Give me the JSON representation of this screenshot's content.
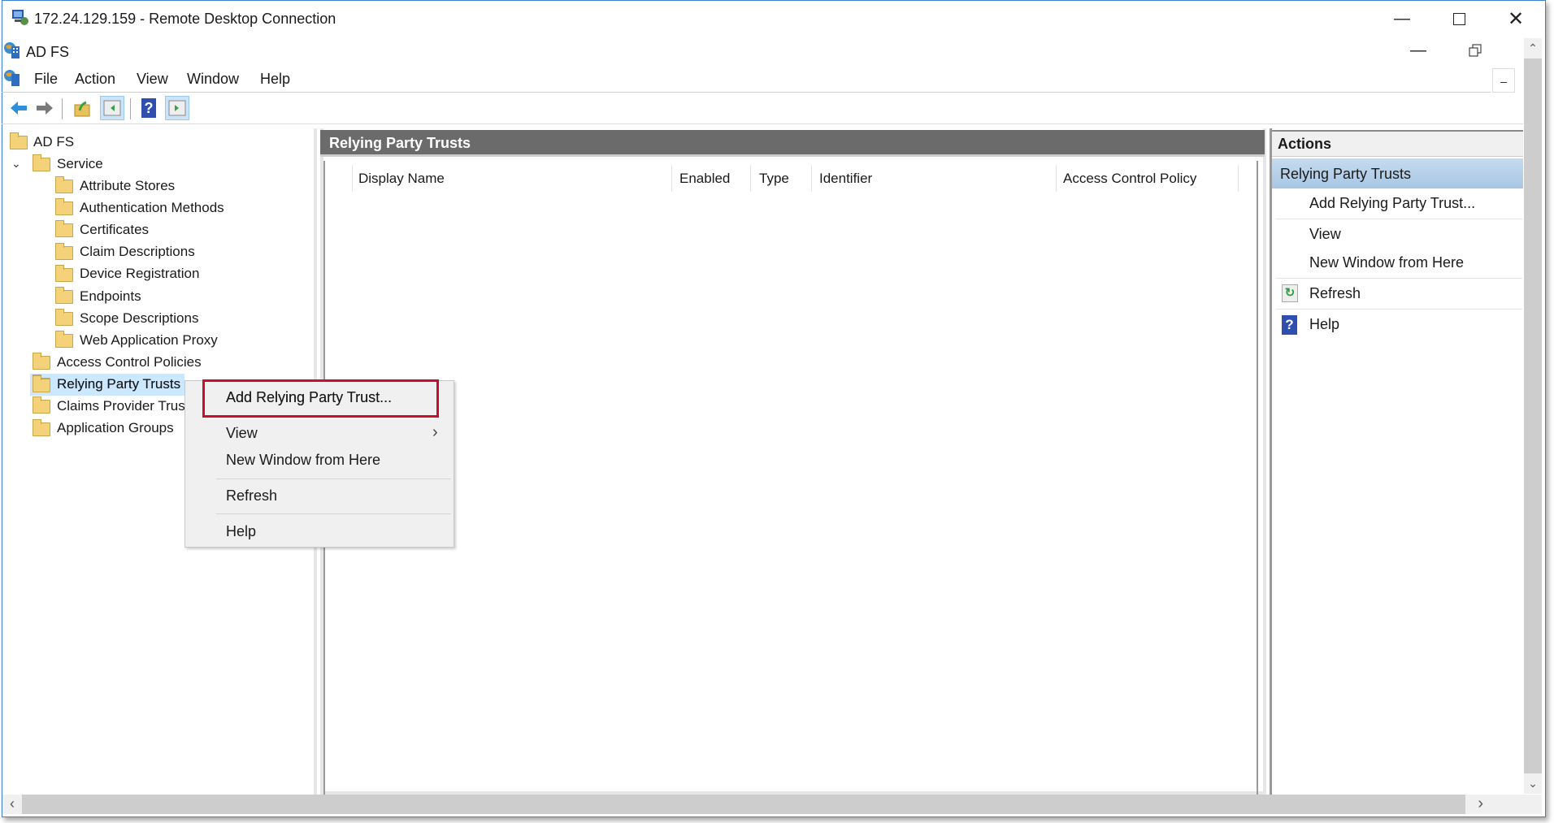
{
  "rdp": {
    "title": "172.24.129.159 - Remote Desktop Connection"
  },
  "mmc": {
    "title": "AD FS"
  },
  "menu": [
    "File",
    "Action",
    "View",
    "Window",
    "Help"
  ],
  "tree": {
    "root": "AD FS",
    "service": "Service",
    "service_children": [
      "Attribute Stores",
      "Authentication Methods",
      "Certificates",
      "Claim Descriptions",
      "Device Registration",
      "Endpoints",
      "Scope Descriptions",
      "Web Application Proxy"
    ],
    "top_items": [
      "Access Control Policies",
      "Relying Party Trusts",
      "Claims Provider Trusts",
      "Application Groups"
    ],
    "selected": "Relying Party Trusts"
  },
  "center": {
    "title": "Relying Party Trusts",
    "columns": [
      "Display Name",
      "Enabled",
      "Type",
      "Identifier",
      "Access Control Policy"
    ]
  },
  "context_menu": {
    "items": [
      "Add Relying Party Trust...",
      "View",
      "New Window from Here",
      "Refresh",
      "Help"
    ],
    "highlighted": "Add Relying Party Trust...",
    "highlight_color": "#c8102e"
  },
  "actions": {
    "title": "Actions",
    "section": "Relying Party Trusts",
    "items": [
      "Add Relying Party Trust...",
      "View",
      "New Window from Here",
      "Refresh",
      "Help"
    ]
  }
}
